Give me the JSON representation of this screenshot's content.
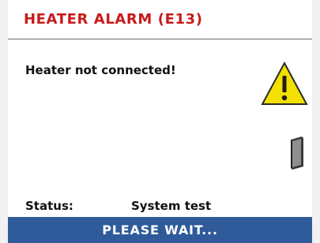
{
  "header": {
    "title": "HEATER ALARM (E13)"
  },
  "main": {
    "message": "Heater not connected!",
    "status_label": "Status:",
    "status_value": "System test",
    "icons": {
      "warning": "warning-triangle-icon",
      "device": "heater-device-icon"
    }
  },
  "footer": {
    "text": "PLEASE WAIT..."
  },
  "colors": {
    "title": "#c81b1b",
    "footer_bg": "#2f5b9a",
    "warning_fill": "#f2e000"
  }
}
